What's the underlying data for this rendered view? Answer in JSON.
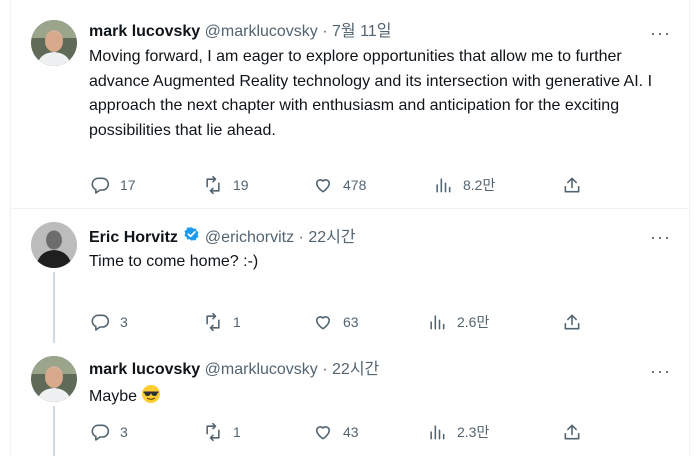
{
  "tweets": [
    {
      "name": "mark lucovsky",
      "handle": "@marklucovsky",
      "separator": "·",
      "time": "7월 11일",
      "more": "···",
      "text": "Moving forward, I am eager to explore opportunities that allow me to further advance Augmented Reality technology and its intersection with generative AI. I approach the next chapter with enthusiasm and anticipation for the exciting possibilities that lie ahead.",
      "replies": "17",
      "retweets": "19",
      "likes": "478",
      "views": "8.2만"
    },
    {
      "name": "Eric Horvitz",
      "verified": true,
      "handle": "@erichorvitz",
      "separator": "·",
      "time": "22시간",
      "more": "···",
      "text": "Time to come home? :-)",
      "replies": "3",
      "retweets": "1",
      "likes": "63",
      "views": "2.6만"
    },
    {
      "name": "mark lucovsky",
      "handle": "@marklucovsky",
      "separator": "·",
      "time": "22시간",
      "more": "···",
      "text": "Maybe",
      "emoji": "smiling-face-with-sunglasses",
      "replies": "3",
      "retweets": "1",
      "likes": "43",
      "views": "2.3만"
    }
  ],
  "colors": {
    "text": "#0f1419",
    "secondary": "#536471",
    "verified": "#1d9bf0",
    "divider": "#eff3f4",
    "thread_line": "#cfd9de"
  }
}
